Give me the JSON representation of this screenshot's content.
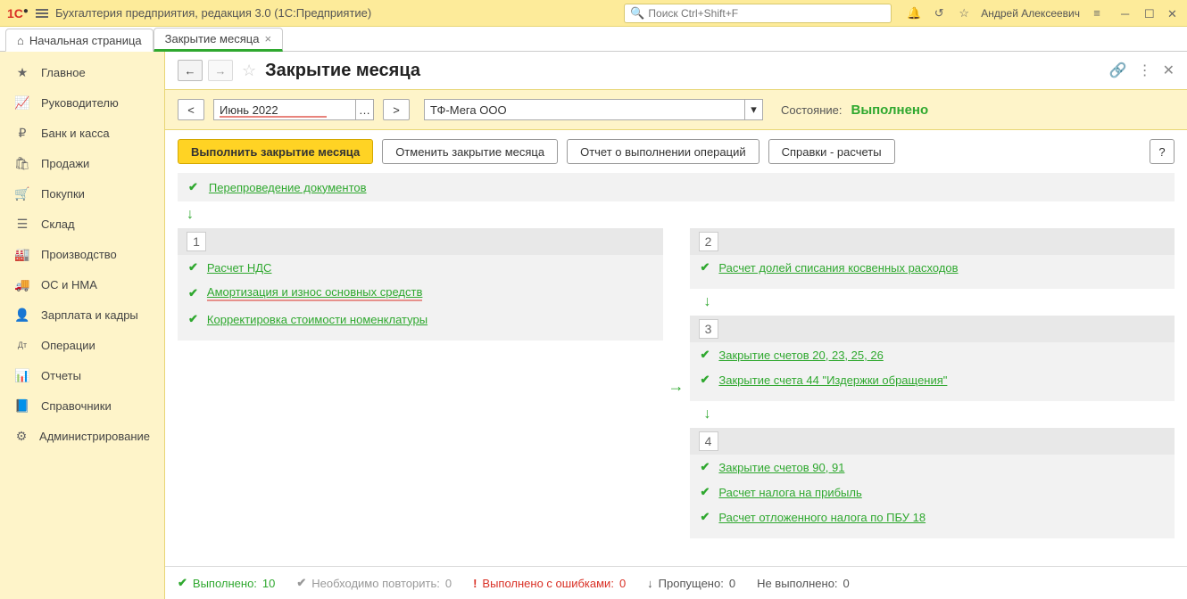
{
  "app": {
    "title": "Бухгалтерия предприятия, редакция 3.0  (1С:Предприятие)",
    "search_placeholder": "Поиск Ctrl+Shift+F",
    "username": "Андрей Алексеевич"
  },
  "tabs": {
    "home": "Начальная страница",
    "active": "Закрытие месяца"
  },
  "sidebar": {
    "items": [
      {
        "label": "Главное",
        "icon": "★"
      },
      {
        "label": "Руководителю",
        "icon": "📈"
      },
      {
        "label": "Банк и касса",
        "icon": "₽"
      },
      {
        "label": "Продажи",
        "icon": "🛍"
      },
      {
        "label": "Покупки",
        "icon": "🛒"
      },
      {
        "label": "Склад",
        "icon": "☰"
      },
      {
        "label": "Производство",
        "icon": "🏭"
      },
      {
        "label": "ОС и НМА",
        "icon": "🚚"
      },
      {
        "label": "Зарплата и кадры",
        "icon": "👤"
      },
      {
        "label": "Операции",
        "icon": "Дт"
      },
      {
        "label": "Отчеты",
        "icon": "📊"
      },
      {
        "label": "Справочники",
        "icon": "📘"
      },
      {
        "label": "Администрирование",
        "icon": "⚙"
      }
    ]
  },
  "page": {
    "title": "Закрытие месяца",
    "period": "Июнь 2022",
    "org": "ТФ-Мега ООО",
    "status_label": "Состояние:",
    "status_value": "Выполнено"
  },
  "buttons": {
    "execute": "Выполнить закрытие месяца",
    "cancel": "Отменить закрытие месяца",
    "report": "Отчет о выполнении операций",
    "refs": "Справки - расчеты",
    "help": "?"
  },
  "ops": {
    "repost": "Перепроведение документов",
    "stage1": {
      "num": "1",
      "items": [
        "Расчет НДС",
        "Амортизация и износ основных средств",
        "Корректировка стоимости номенклатуры"
      ]
    },
    "stage2": {
      "num": "2",
      "items": [
        "Расчет долей списания косвенных расходов"
      ]
    },
    "stage3": {
      "num": "3",
      "items": [
        "Закрытие счетов 20, 23, 25, 26",
        "Закрытие счета 44 \"Издержки обращения\""
      ]
    },
    "stage4": {
      "num": "4",
      "items": [
        "Закрытие счетов 90, 91",
        "Расчет налога на прибыль",
        "Расчет отложенного налога по ПБУ 18"
      ]
    }
  },
  "statusbar": {
    "done_label": "Выполнено:",
    "done_val": "10",
    "repeat_label": "Необходимо повторить:",
    "repeat_val": "0",
    "errors_label": "Выполнено с ошибками:",
    "errors_val": "0",
    "skipped_label": "Пропущено:",
    "skipped_val": "0",
    "notdone_label": "Не выполнено:",
    "notdone_val": "0"
  }
}
